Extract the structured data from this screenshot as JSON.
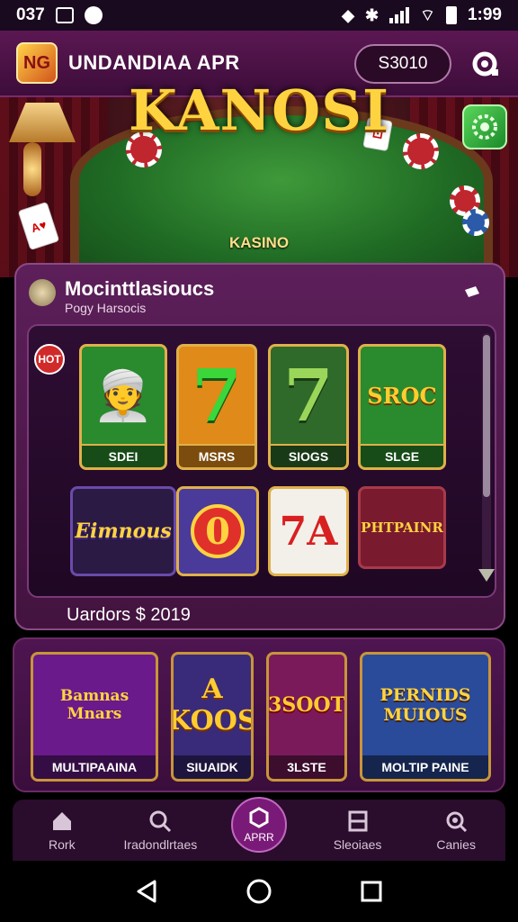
{
  "status_bar": {
    "time_left": "037",
    "time_right": "1:99"
  },
  "app_bar": {
    "logo_text": "NG",
    "title": "UNDANDIAA APR",
    "balance": "S3010"
  },
  "hero": {
    "title": "KANOSI",
    "subtitle": "KASINO"
  },
  "main_panel": {
    "title": "Mocinttlasioucs",
    "subtitle": "Pogy Harsocis",
    "hot_badge": "HOT",
    "games": [
      {
        "label": "SDEI",
        "art": "👳",
        "bg": "#2a8a2e"
      },
      {
        "label": "MSRS",
        "art": "7",
        "bg": "#e08a1a"
      },
      {
        "label": "SIOGS",
        "art": "7",
        "bg": "#2f6a2a"
      },
      {
        "label": "SLGE",
        "art": "SROC",
        "bg": "#2a8a2e"
      },
      {
        "label": "",
        "art": "Eimnous",
        "bg": "#2a1a44"
      },
      {
        "label": "",
        "art": "0",
        "bg": "#4a3a9a"
      },
      {
        "label": "",
        "art": "7A",
        "bg": "#f3f0ea"
      },
      {
        "label": "",
        "art": "PHTPAINR",
        "bg": "#7a1a2e"
      }
    ],
    "footer_text": "Uardors $ 2019"
  },
  "promos": [
    {
      "label": "MULTIPAAINA",
      "art": "Bamnas Mnars",
      "bg": "#6a1a8a"
    },
    {
      "label": "SIUAIDK",
      "art": "A KOOS",
      "bg": "#3a2a7a"
    },
    {
      "label": "3LSTE",
      "art": "3SOOT",
      "bg": "#7a1a5a"
    },
    {
      "label": "MOLTIP PAINE",
      "art": "PERNIDS MUIOUS",
      "bg": "#2a4a9a"
    }
  ],
  "nav": [
    {
      "label": "Rork",
      "icon": "home-icon"
    },
    {
      "label": "Iradondlrtaes",
      "icon": "search-icon"
    },
    {
      "label": "APRR",
      "icon": "app-icon"
    },
    {
      "label": "Sleoiaes",
      "icon": "slots-icon"
    },
    {
      "label": "Canies",
      "icon": "games-icon"
    }
  ]
}
